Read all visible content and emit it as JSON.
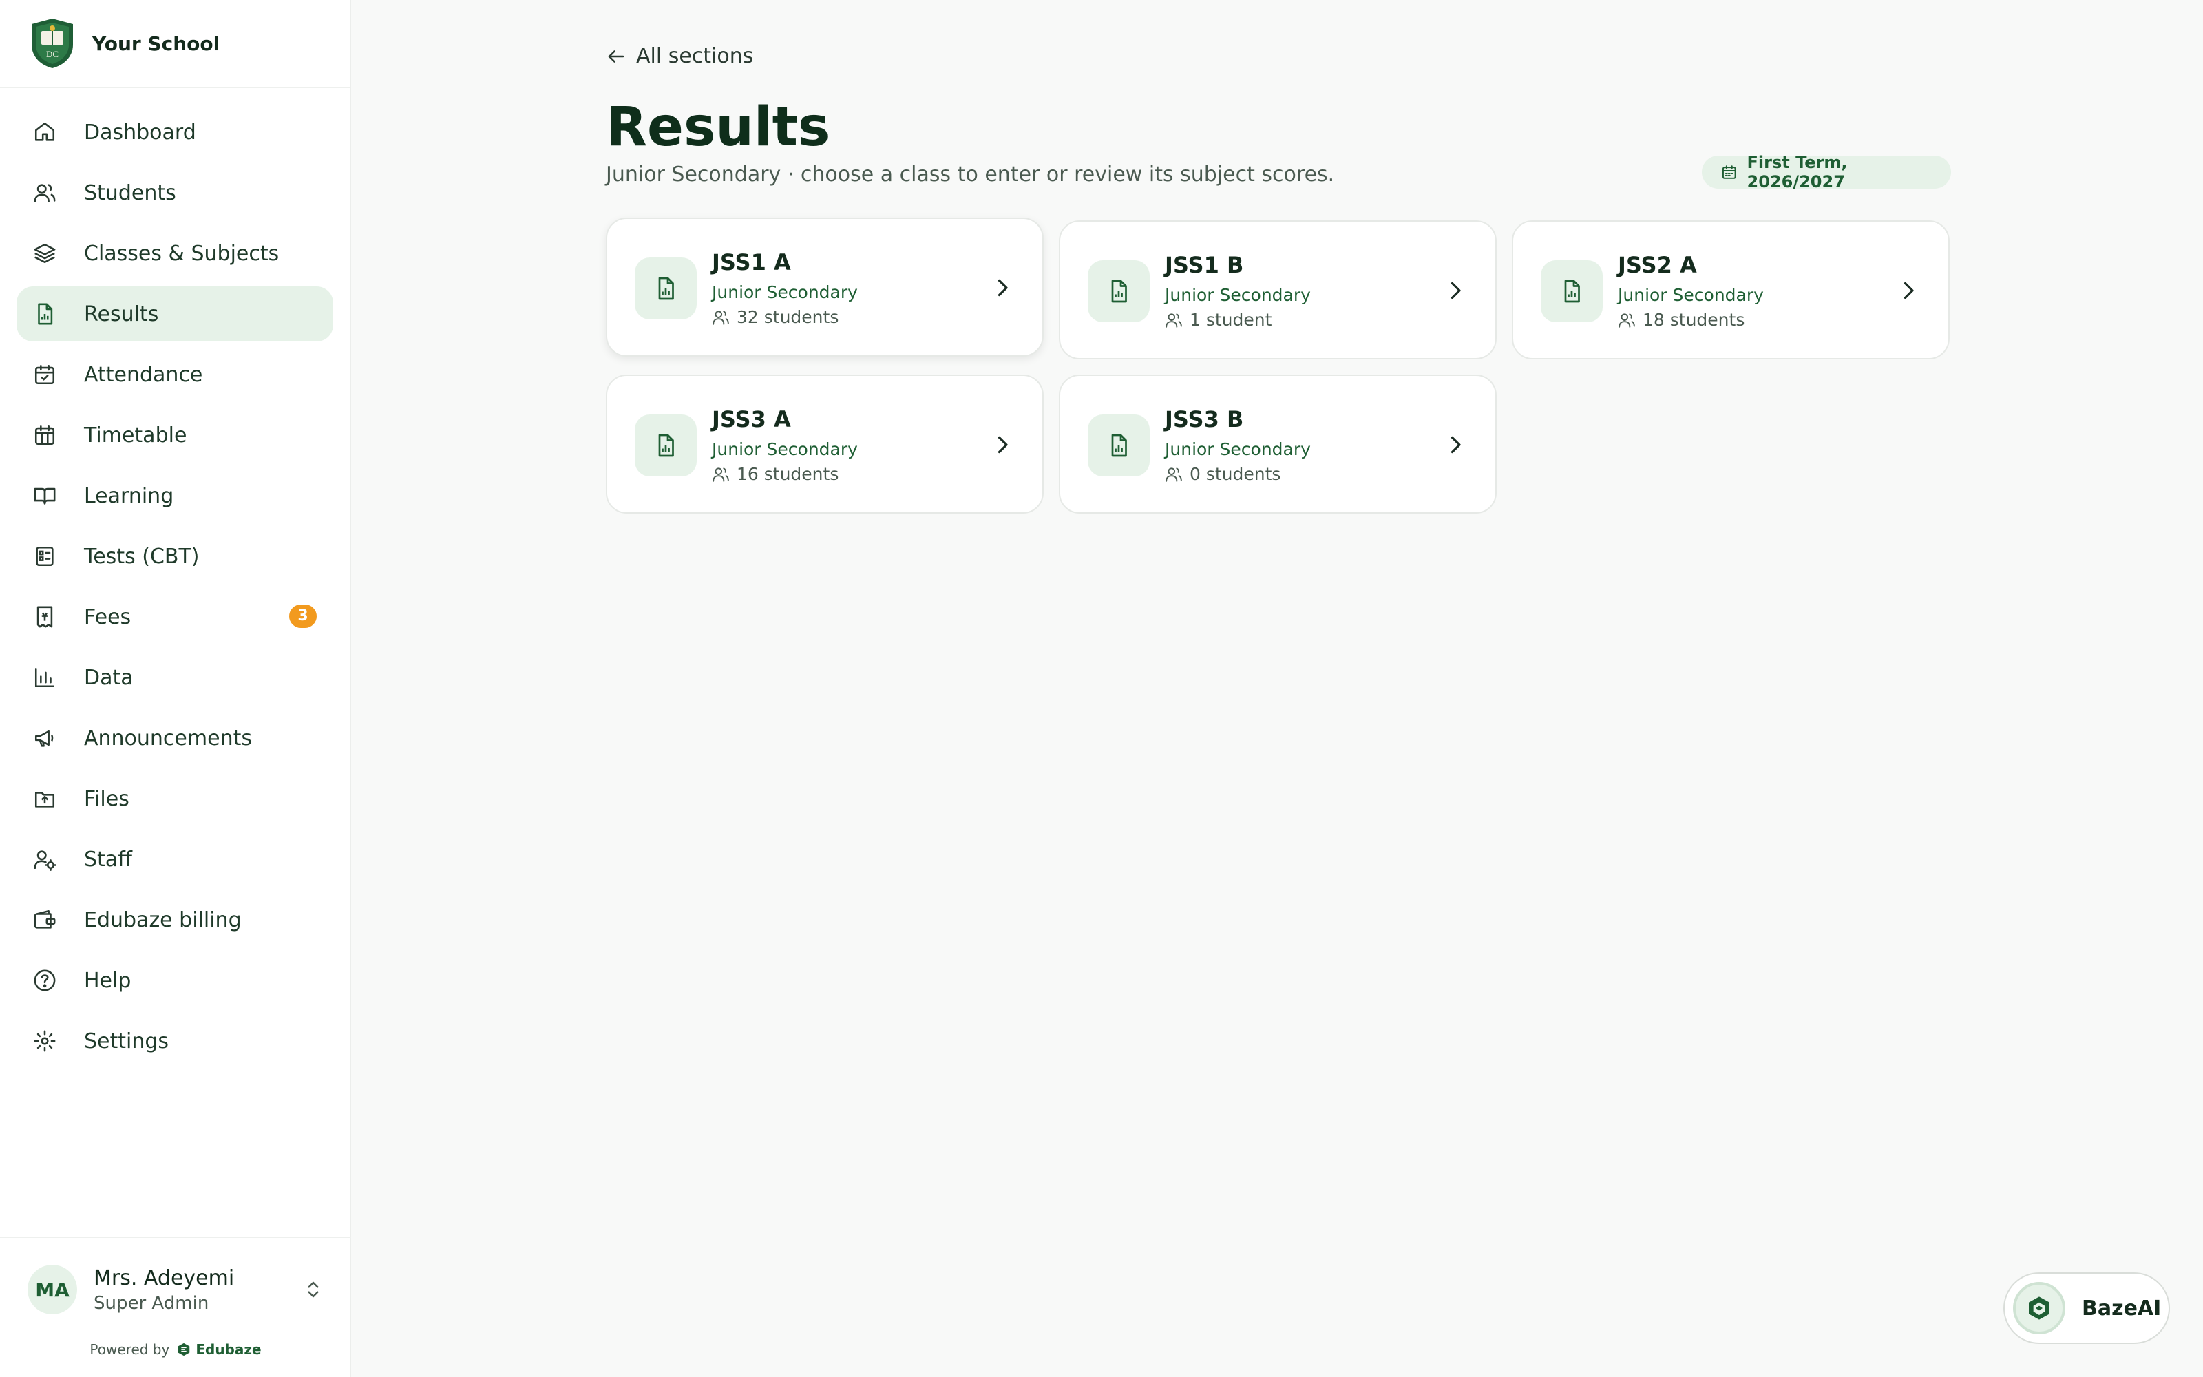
{
  "brand": {
    "name": "Your School",
    "logo_text": "DC"
  },
  "nav": {
    "items": [
      {
        "label": "Dashboard",
        "icon": "home-icon"
      },
      {
        "label": "Students",
        "icon": "users-icon"
      },
      {
        "label": "Classes & Subjects",
        "icon": "layers-icon"
      },
      {
        "label": "Results",
        "icon": "file-chart-icon",
        "active": true
      },
      {
        "label": "Attendance",
        "icon": "calendar-check-icon"
      },
      {
        "label": "Timetable",
        "icon": "calendar-grid-icon"
      },
      {
        "label": "Learning",
        "icon": "book-open-icon"
      },
      {
        "label": "Tests (CBT)",
        "icon": "checklist-icon"
      },
      {
        "label": "Fees",
        "icon": "receipt-icon",
        "badge": "3"
      },
      {
        "label": "Data",
        "icon": "bar-chart-icon"
      },
      {
        "label": "Announcements",
        "icon": "megaphone-icon"
      },
      {
        "label": "Files",
        "icon": "folder-upload-icon"
      },
      {
        "label": "Staff",
        "icon": "user-cog-icon"
      },
      {
        "label": "Edubaze billing",
        "icon": "wallet-icon"
      },
      {
        "label": "Help",
        "icon": "help-circle-icon"
      },
      {
        "label": "Settings",
        "icon": "sun-gear-icon"
      }
    ]
  },
  "user": {
    "initials": "MA",
    "name": "Mrs. Adeyemi",
    "role": "Super Admin"
  },
  "powered": {
    "prefix": "Powered by",
    "name": "Edubaze"
  },
  "main": {
    "back_label": "All sections",
    "title": "Results",
    "subtitle": "Junior Secondary · choose a class to enter or review its subject scores.",
    "term": "First Term, 2026/2027"
  },
  "classes": [
    {
      "name": "JSS1 A",
      "section": "Junior Secondary",
      "count": "32 students"
    },
    {
      "name": "JSS1 B",
      "section": "Junior Secondary",
      "count": "1 student"
    },
    {
      "name": "JSS2 A",
      "section": "Junior Secondary",
      "count": "18 students"
    },
    {
      "name": "JSS3 A",
      "section": "Junior Secondary",
      "count": "16 students"
    },
    {
      "name": "JSS3 B",
      "section": "Junior Secondary",
      "count": "0 students"
    }
  ],
  "ai": {
    "label": "BazeAI"
  },
  "colors": {
    "accent": "#1e5e33",
    "active_bg": "#e6f2e8",
    "badge": "#f29a1e"
  }
}
